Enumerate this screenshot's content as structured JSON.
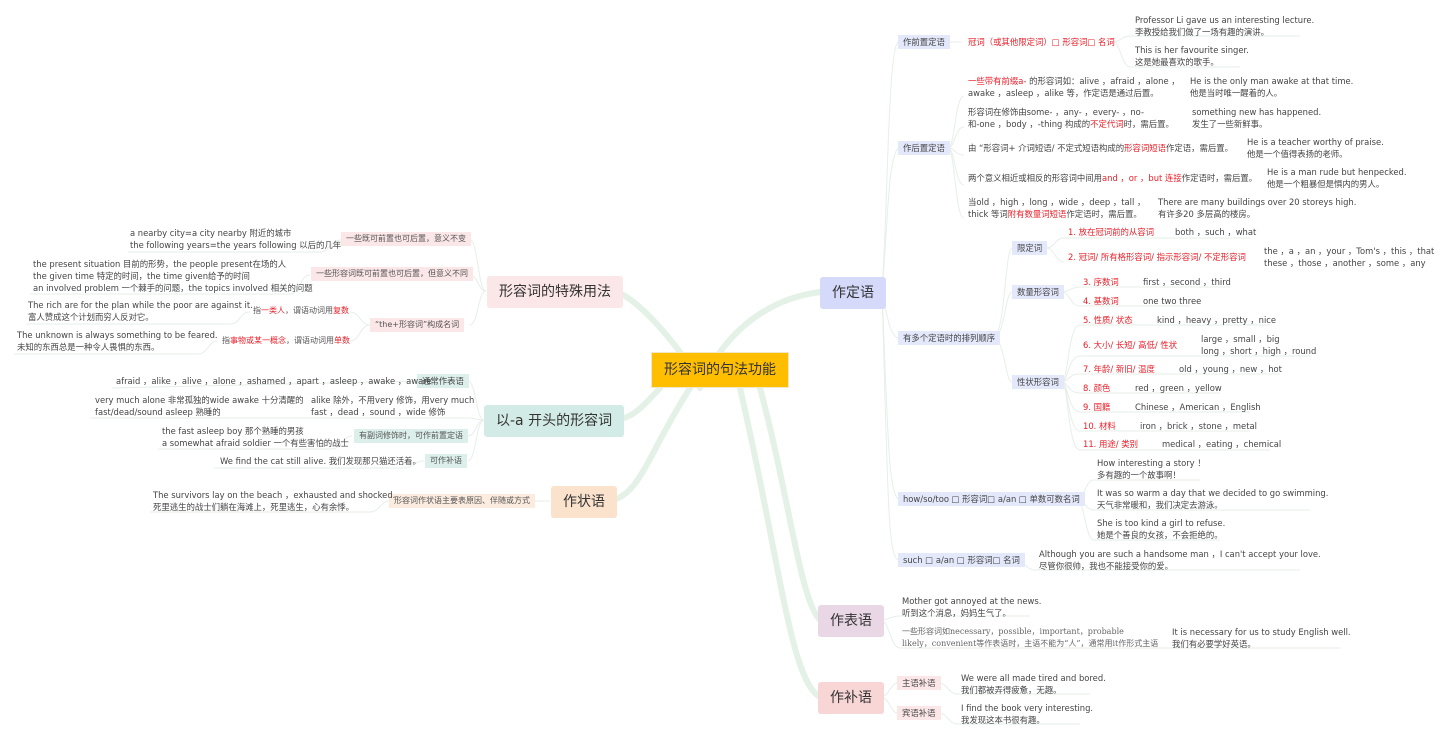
{
  "root": "形容词的句法功能",
  "branches": {
    "attributive": {
      "title": "作定语",
      "pre": {
        "label": "作前置定语",
        "rule": "冠词（或其他限定词）□ 形容词□ 名词",
        "examples": [
          {
            "en": "Professor Li gave us an interesting lecture.",
            "zh": "李教授给我们做了一场有趣的演讲。"
          },
          {
            "en": "This is her favourite singer.",
            "zh": "这是她最喜欢的歌手。"
          }
        ]
      },
      "post": {
        "label": "作后置定语",
        "rules": [
          {
            "parts": [
              {
                "t": "一些带有前缀a-",
                "red": true
              },
              {
                "t": " 的形容词如：alive ，afraid ，alone ，",
                "red": false
              }
            ],
            "line2": [
              {
                "t": "awake ，asleep ，alike 等，作定语是通过后置。",
                "red": false
              }
            ],
            "en": "He is the only man awake at that time.",
            "zh": "他是当时唯一醒着的人。"
          },
          {
            "parts": [
              {
                "t": "形容词在修饰由some- ，any- ，every- ，no-",
                "red": false
              }
            ],
            "line2": [
              {
                "t": " 和-one ，body ，-thing 构成的",
                "red": false
              },
              {
                "t": "不定代词",
                "red": true
              },
              {
                "t": "时，需后置。",
                "red": false
              }
            ],
            "en": "something new has happened.",
            "zh": "发生了一些新鲜事。"
          },
          {
            "parts": [
              {
                "t": "由 “形容词+ 介词短语/ 不定式短语构成的",
                "red": false
              },
              {
                "t": "形容词短语",
                "red": true
              },
              {
                "t": "作定语，需后置。",
                "red": false
              }
            ],
            "line2": [],
            "en": "He is a teacher worthy of praise.",
            "zh": "他是一个值得表扬的老师。"
          },
          {
            "parts": [
              {
                "t": "两个意义相近或相反的形容词中间用",
                "red": false
              },
              {
                "t": "and ，or ，but 连接",
                "red": true
              },
              {
                "t": "作定语时，需后置。",
                "red": false
              }
            ],
            "line2": [],
            "en": "He is a man rude but henpecked.",
            "zh": "他是一个粗暴但是惧内的男人。"
          },
          {
            "parts": [
              {
                "t": "当old ，high ，long ，wide ，deep ，tall ，",
                "red": false
              }
            ],
            "line2": [
              {
                "t": "thick 等词",
                "red": false
              },
              {
                "t": "附有数量词短语",
                "red": true
              },
              {
                "t": "作定语时，需后置。",
                "red": false
              }
            ],
            "en": "There are many buildings over 20 storeys high.",
            "zh": "有许多20 多层高的楼房。"
          }
        ]
      },
      "order": {
        "label": "有多个定语时的排列顺序",
        "groups": [
          {
            "label": "限定词",
            "items": [
              {
                "k": "1. 放在冠词前的从容词",
                "v": "both ，such ，what"
              },
              {
                "k": "2. 冠词/ 所有格形容词/ 指示形容词/ 不定形容词",
                "v": "the ，a ，an ，your ，Tom's ，this ，that",
                "v2": "these ，those ，another ，some ，any"
              }
            ]
          },
          {
            "label": "数量形容词",
            "items": [
              {
                "k": "3. 序数词",
                "v": "first ，second ，third"
              },
              {
                "k": "4. 基数词",
                "v": "one two three"
              }
            ]
          },
          {
            "label": "性状形容词",
            "items": [
              {
                "k": "5. 性质/ 状态",
                "v": "kind ，heavy ，pretty ，nice"
              },
              {
                "k": "6. 大小/ 长短/ 高低/ 性状",
                "v": "large ，small ，big",
                "v2": "long ，short ，high ，round"
              },
              {
                "k": "7. 年龄/ 新旧/ 温度",
                "v": "old ，young ，new ，hot"
              },
              {
                "k": "8. 颜色",
                "v": "red ，green ，yellow"
              },
              {
                "k": "9. 国籍",
                "v": "Chinese ，American ，English"
              },
              {
                "k": "10. 材料",
                "v": "iron ，brick ，stone ，metal"
              },
              {
                "k": "11. 用途/ 类别",
                "v": "medical ，eating ，chemical"
              }
            ]
          }
        ]
      },
      "how": {
        "label": "how/so/too □ 形容词□ a/an □ 单数可数名词",
        "examples": [
          {
            "en": "How interesting a story ！",
            "zh": "多有趣的一个故事啊！"
          },
          {
            "en": "It was so warm a day that we decided to go swimming.",
            "zh": "天气非常暖和，我们决定去游泳。"
          },
          {
            "en": "She is too kind a girl to refuse.",
            "zh": "她是个善良的女孩，不会拒绝的。"
          }
        ]
      },
      "such": {
        "label": "such □ a/an □ 形容词□ 名词",
        "en": "Although you are such a handsome man ，I can't accept your love.",
        "zh": "尽管你很帅，我也不能接受你的爱。"
      }
    },
    "predicative": {
      "title": "作表语",
      "ex1": {
        "en": "Mother got annoyed at the news.",
        "zh": "听到这个消息，妈妈生气了。"
      },
      "rule_l1": "一些形容词如necessary，possible，important，probable",
      "rule_l2": "likely，convenient等作表语时，主语不能为“人”，通常用it作形式主语",
      "ex2": {
        "en": "It is necessary for us to study English well.",
        "zh": "我们有必要学好英语。"
      }
    },
    "complement": {
      "title": "作补语",
      "items": [
        {
          "label": "主语补语",
          "en": "We were all made tired and bored.",
          "zh": "我们都被弄得疲惫，无趣。"
        },
        {
          "label": "宾语补语",
          "en": "I find the book very interesting.",
          "zh": "我发现这本书很有趣。"
        }
      ]
    },
    "special": {
      "title": "形容词的特殊用法",
      "a": {
        "label": "一些既可前置也可后置，意义不变",
        "l1": "a nearby city=a city nearby 附近的城市",
        "l2": "the following years=the years following 以后的几年"
      },
      "b": {
        "label": "一些形容词既可前置也可后置，但意义不同",
        "l1": "the present situation 目前的形势，the people present在场的人",
        "l2": "the given time 特定的时间，the time given给予的时间",
        "l3": "an involved problem 一个棘手的问题，the topics involved 相关的问题"
      },
      "c": {
        "label": "“the+形容词”构成名词",
        "plural": {
          "pre": "指",
          "red1": "一类人",
          "mid": "，谓语动词用",
          "red2": "复数",
          "en": "The rich are for the plan while the poor are against it.",
          "zh": "富人赞成这个计划而穷人反对它。"
        },
        "singular": {
          "pre": "指",
          "red1": "事物或某一概念",
          "mid": "，谓语动词用",
          "red2": "单数",
          "en": "The unknown is always something to be feared.",
          "zh": "未知的东西总是一种令人畏惧的东西。"
        }
      }
    },
    "a_adj": {
      "title": "以-a 开头的形容词",
      "usual": {
        "label": "通常作表语",
        "text": "afraid ，alike ，alive ，alone ，ashamed ，apart ，asleep ，awake ，aware"
      },
      "mod": {
        "l1": "very much alone 非常孤独的wide awake 十分清醒的",
        "l2": "fast/dead/sound asleep 熟睡的",
        "r1": "alike 除外，不用very 修饰，用very much",
        "r2": "fast ，dead ，sound ，wide 修饰"
      },
      "adv": {
        "label": "有副词修饰时，可作前置定语",
        "l1": "the fast asleep boy 那个熟睡的男孩",
        "l2": "a somewhat afraid soldier 一个有些害怕的战士"
      },
      "comp": {
        "label": "可作补语",
        "text": "We find the cat still alive. 我们发现那只猫还活着。"
      }
    },
    "adverbial": {
      "title": "作状语",
      "label": "形容词作状语主要表原因、伴随或方式",
      "en": "The survivors lay on the beach ，exhausted and shocked.",
      "zh": "死里逃生的战士们躺在海滩上，死里逃生，心有余悸。"
    }
  },
  "colors": {
    "root": "#ffbf00",
    "attributive": "#d5dafb",
    "predicative": "#ead7e6",
    "complement": "#f8d6d6",
    "special": "#fbe6e8",
    "a_adj": "#d3ebe6",
    "adverbial": "#fbe2cc",
    "red": "#e8202a",
    "line": "#e3f0e8"
  }
}
